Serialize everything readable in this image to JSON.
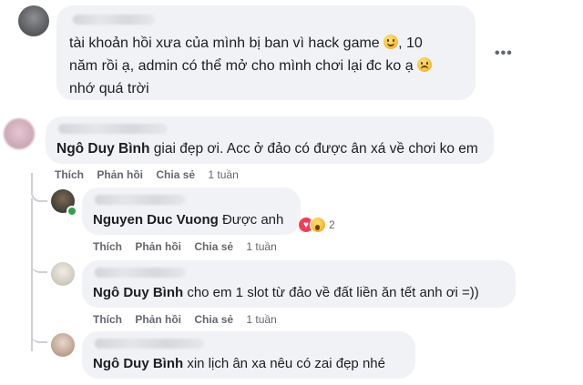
{
  "comments": [
    {
      "text_lines": [
        "tài khoản hồi xưa của mình bị ban vì hack game",
        ", 10",
        "năm rồi ạ, admin có thể mở cho mình chơi lại đc ko ạ",
        "nhớ quá trời"
      ],
      "emoji_1": "smile-emoji",
      "emoji_2": "sad-emoji",
      "more": "•••"
    },
    {
      "mention": "Ngô Duy Bình",
      "text": " giai đẹp ơi. Acc ở đảo có được ân xá về chơi ko em",
      "actions": {
        "like": "Thích",
        "reply": "Phản hồi",
        "share": "Chia sẻ",
        "time": "1 tuần"
      }
    }
  ],
  "replies": [
    {
      "mention": "Nguyen Duc Vuong",
      "text": " Được anh",
      "reactions": {
        "icons": [
          "heart-reaction",
          "wow-reaction"
        ],
        "count": "2"
      },
      "actions": {
        "like": "Thích",
        "reply": "Phản hồi",
        "share": "Chia sẻ",
        "time": "1 tuần"
      }
    },
    {
      "mention": "Ngô Duy Bình",
      "text": " cho em 1 slot từ đảo về đất liền ăn tết anh ơi =))",
      "actions": {
        "like": "Thích",
        "reply": "Phản hồi",
        "share": "Chia sẻ",
        "time": "1 tuần"
      }
    },
    {
      "mention": "Ngô Duy Bình",
      "text": " xin lịch ân xa nêu có zai đẹp nhé"
    }
  ],
  "colors": {
    "bubble": "#f0f2f5",
    "meta": "#65676b",
    "online": "#31a24c",
    "heart": "#f33e58"
  }
}
